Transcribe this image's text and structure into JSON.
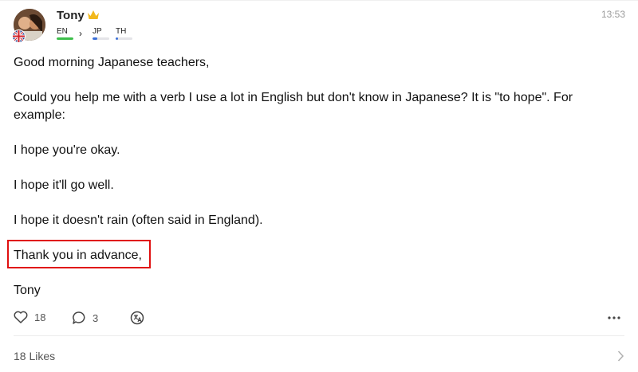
{
  "post": {
    "author": "Tony",
    "time": "13:53",
    "languages": [
      {
        "code": "EN",
        "level": 1.0,
        "color": "#3cbf4a"
      },
      {
        "code": "JP",
        "level": 0.3,
        "color": "#3a6fd8"
      },
      {
        "code": "TH",
        "level": 0.15,
        "color": "#3a6fd8"
      }
    ],
    "paragraphs": [
      "Good morning Japanese teachers,",
      "Could you help me with a verb I use a lot in English but don't know in Japanese? It is \"to hope\". For example:",
      "I hope you're okay.",
      "I hope it'll go well.",
      "I hope it doesn't rain (often said in England).",
      "Thank you in advance,",
      "Tony"
    ],
    "likes_count": "18",
    "comments_count": "3",
    "likes_summary": "18 Likes"
  },
  "icons": {
    "crown": "crown-icon",
    "like": "heart-icon",
    "comment": "comment-bubble-icon",
    "translate": "translate-icon",
    "more": "more-horizontal-icon",
    "chevron": "chevron-right-icon",
    "flag": "uk-flag-icon"
  },
  "colors": {
    "highlight_border": "#e01010",
    "crown": "#f2b81c"
  }
}
